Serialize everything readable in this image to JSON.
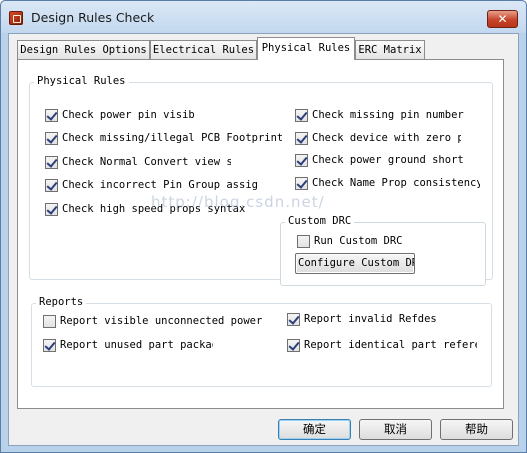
{
  "window": {
    "title": "Design Rules Check",
    "close_label": "✕"
  },
  "tabs": [
    {
      "label": "Design Rules Options"
    },
    {
      "label": "Electrical Rules"
    },
    {
      "label": "Physical Rules"
    },
    {
      "label": "ERC Matrix"
    }
  ],
  "active_tab": "Physical Rules",
  "physical_rules": {
    "group_label": "Physical Rules",
    "left_checks": [
      {
        "label": "Check power pin visib",
        "checked": true
      },
      {
        "label": "Check missing/illegal PCB Footprint p",
        "checked": true
      },
      {
        "label": "Check Normal Convert view sy",
        "checked": true
      },
      {
        "label": "Check incorrect Pin Group assign",
        "checked": true
      },
      {
        "label": "Check high speed props syntax",
        "checked": true
      }
    ],
    "right_checks": [
      {
        "label": "Check missing pin number",
        "checked": true
      },
      {
        "label": "Check device with zero pi",
        "checked": true
      },
      {
        "label": "Check power ground short",
        "checked": true
      },
      {
        "label": "Check Name Prop consistency",
        "checked": true
      }
    ]
  },
  "custom_drc": {
    "group_label": "Custom DRC",
    "run_label": "Run Custom DRC",
    "run_checked": false,
    "configure_label": "Configure Custom DRC"
  },
  "reports": {
    "group_label": "Reports",
    "items": [
      {
        "label": "Report visible unconnected power",
        "checked": false
      },
      {
        "label": "Report invalid Refdes",
        "checked": true
      },
      {
        "label": "Report unused part packag",
        "checked": true
      },
      {
        "label": "Report identical part refere",
        "checked": true
      }
    ]
  },
  "buttons": {
    "ok": "确定",
    "cancel": "取消",
    "help": "帮助"
  },
  "watermark": "http://blog.csdn.net/"
}
